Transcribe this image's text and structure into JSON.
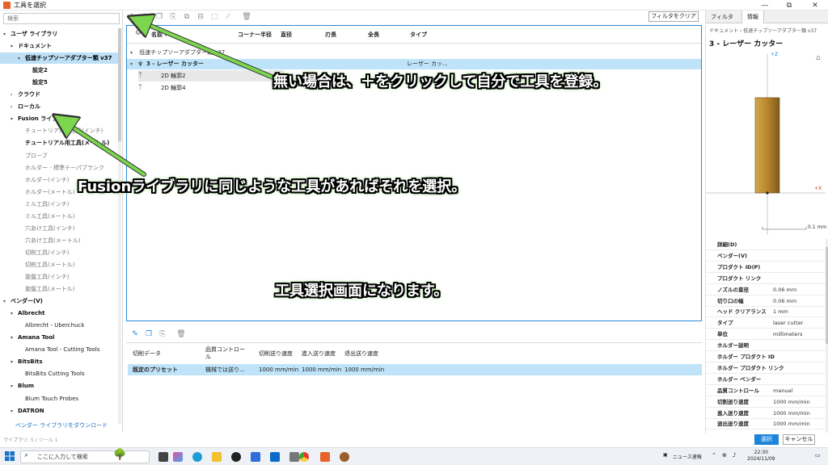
{
  "window": {
    "title": "工具を選択",
    "controls": [
      "—",
      "⧉",
      "✕"
    ]
  },
  "left_panel": {
    "search_placeholder": "検索",
    "tree": [
      {
        "label": "ユーザ ライブラリ",
        "level": 0,
        "arrow": "▾",
        "style": "bold"
      },
      {
        "label": "ドキュメント",
        "level": 1,
        "arrow": "▾",
        "style": "bold"
      },
      {
        "label": "低速チップソーアダプター類 v37",
        "level": 2,
        "arrow": "▾",
        "style": "sel"
      },
      {
        "label": "設定2",
        "level": 3,
        "arrow": "",
        "style": "bold"
      },
      {
        "label": "設定5",
        "level": 3,
        "arrow": "",
        "style": "bold"
      },
      {
        "label": "クラウド",
        "level": 1,
        "arrow": "›",
        "style": "bold"
      },
      {
        "label": "ローカル",
        "level": 1,
        "arrow": "›",
        "style": "bold"
      },
      {
        "label": "Fusion ライブラリ",
        "level": 1,
        "arrow": "▾",
        "style": "bold"
      },
      {
        "label": "チュートリアル用工具(インチ)",
        "level": 2,
        "arrow": "",
        "style": "gray"
      },
      {
        "label": "チュートリアル用工具(メートル)",
        "level": 2,
        "arrow": "",
        "style": "bold"
      },
      {
        "label": "プローブ",
        "level": 2,
        "arrow": "",
        "style": "gray"
      },
      {
        "label": "ホルダー - 標準テーパブランク",
        "level": 2,
        "arrow": "",
        "style": "gray"
      },
      {
        "label": "ホルダー(インチ)",
        "level": 2,
        "arrow": "",
        "style": "gray"
      },
      {
        "label": "ホルダー(メートル)",
        "level": 2,
        "arrow": "",
        "style": "gray"
      },
      {
        "label": "ミル工具(インチ)",
        "level": 2,
        "arrow": "",
        "style": "gray"
      },
      {
        "label": "ミル工具(メートル)",
        "level": 2,
        "arrow": "",
        "style": "gray"
      },
      {
        "label": "穴あけ工具(インチ)",
        "level": 2,
        "arrow": "",
        "style": "gray"
      },
      {
        "label": "穴あけ工具(メートル)",
        "level": 2,
        "arrow": "",
        "style": "gray"
      },
      {
        "label": "切削工具(インチ)",
        "level": 2,
        "arrow": "",
        "style": "gray"
      },
      {
        "label": "切削工具(メートル)",
        "level": 2,
        "arrow": "",
        "style": "gray"
      },
      {
        "label": "旋盤工具(インチ)",
        "level": 2,
        "arrow": "",
        "style": "gray"
      },
      {
        "label": "旋盤工具(メートル)",
        "level": 2,
        "arrow": "",
        "style": "gray"
      },
      {
        "label": "ベンダー(V)",
        "level": 0,
        "arrow": "▾",
        "style": "bold"
      },
      {
        "label": "Albrecht",
        "level": 1,
        "arrow": "▾",
        "style": "bold"
      },
      {
        "label": "Albrecht - Uberchuck",
        "level": 2,
        "arrow": "",
        "style": "normal"
      },
      {
        "label": "Amana Tool",
        "level": 1,
        "arrow": "▾",
        "style": "bold"
      },
      {
        "label": "Amana Tool - Cutting Tools",
        "level": 2,
        "arrow": "",
        "style": "normal"
      },
      {
        "label": "BitsBits",
        "level": 1,
        "arrow": "▾",
        "style": "bold"
      },
      {
        "label": "BitsBits Cutting Tools",
        "level": 2,
        "arrow": "",
        "style": "normal"
      },
      {
        "label": "Blum",
        "level": 1,
        "arrow": "▾",
        "style": "bold"
      },
      {
        "label": "Blum Touch Probes",
        "level": 2,
        "arrow": "",
        "style": "normal"
      },
      {
        "label": "DATRON",
        "level": 1,
        "arrow": "▾",
        "style": "bold"
      }
    ],
    "vendor_link": "ベンダー ライブラリをダウンロード"
  },
  "toolbar": {
    "icons": [
      "plus-icon",
      "edit-icon",
      "copy-icon",
      "paste-icon",
      "duplicate-icon",
      "holder-icon",
      "select-icon",
      "brush-icon",
      "delete-icon"
    ],
    "filter_clear": "フィルタをクリア"
  },
  "table": {
    "columns": [
      "名前",
      "コーナー半径",
      "直径",
      "刃長",
      "全長",
      "タイプ"
    ],
    "group": "低速チップソーアダプター類 v37",
    "tool": {
      "name": "3 - レーザー カッター",
      "type": "レーザー カッ..."
    },
    "subs": [
      "2D 輪郭2",
      "2D 輪郭4"
    ]
  },
  "presets": {
    "columns": [
      "切削データ",
      "品質コントロール",
      "切削送り速度",
      "進入送り速度",
      "退出送り速度"
    ],
    "row": {
      "name": "既定のプリセット",
      "quality": "機械では送り...",
      "feed": "1000 mm/min",
      "entry": "1000 mm/min",
      "exit": "1000 mm/min"
    }
  },
  "right_panel": {
    "tabs": [
      "フィルタ",
      "情報"
    ],
    "breadcrumb": "ドキュメント  ›  低速チップソーアダプター類 v37",
    "title": "3 - レーザー カッター",
    "axis_z": "+Z",
    "axis_x": "+X",
    "scale": "0.1 mm",
    "properties": [
      {
        "k": "詳細(D)",
        "v": ""
      },
      {
        "k": "ベンダー(V)",
        "v": ""
      },
      {
        "k": "プロダクト ID(P)",
        "v": ""
      },
      {
        "k": "プロダクト リンク",
        "v": ""
      },
      {
        "k": "ノズルの直径",
        "v": "0.06 mm"
      },
      {
        "k": "切り口の幅",
        "v": "0.06 mm"
      },
      {
        "k": "ヘッド クリアランス",
        "v": "1 mm"
      },
      {
        "k": "タイプ",
        "v": "laser cutter"
      },
      {
        "k": "単位",
        "v": "millimeters"
      },
      {
        "k": "ホルダー説明",
        "v": ""
      },
      {
        "k": "ホルダー プロダクト ID",
        "v": ""
      },
      {
        "k": "ホルダー プロダクト リンク",
        "v": ""
      },
      {
        "k": "ホルダー ベンダー",
        "v": ""
      },
      {
        "k": "品質コントロール",
        "v": "manual"
      },
      {
        "k": "切削送り速度",
        "v": "1000 mm/min"
      },
      {
        "k": "進入送り速度",
        "v": "1000 mm/min"
      },
      {
        "k": "退出送り速度",
        "v": "1000 mm/min"
      }
    ]
  },
  "actions": {
    "select": "選択",
    "cancel": "キャンセル",
    "status": "ライブラリ: 5 / ツール 1"
  },
  "taskbar": {
    "search": "ここに入力して検索",
    "news": "ニュース速報",
    "time": "22:30",
    "date": "2024/11/09"
  },
  "annotations": {
    "a1": "無い場合は、＋をクリックして自分で工具を登録。",
    "a2": "Fusionライブラリに同じような工具があればそれを選択。",
    "a3": "工具選択画面になります。"
  },
  "colors": {
    "accent": "#1e84d8",
    "selection": "#bde0f7",
    "arrow_green": "#5bc832",
    "tool_gold": "#b8862e"
  }
}
